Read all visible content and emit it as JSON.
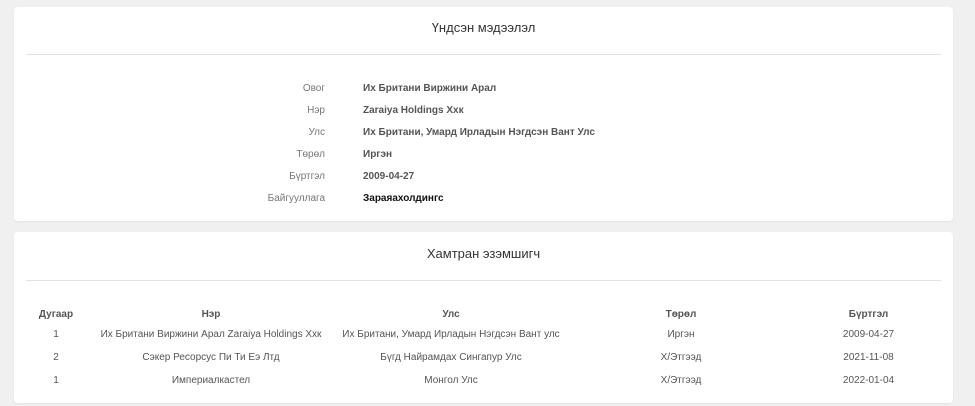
{
  "basic_info": {
    "title": "Үндсэн мэдээлэл",
    "rows": [
      {
        "label": "Овог",
        "value": "Их Британи Виржини Арал"
      },
      {
        "label": "Нэр",
        "value": "Zaraiya Holdings Ххк"
      },
      {
        "label": "Улс",
        "value": "Их Британи, Умард Ирладын Нэгдсэн Вант Улс"
      },
      {
        "label": "Төрөл",
        "value": "Иргэн"
      },
      {
        "label": "Бүртгэл",
        "value": "2009-04-27"
      },
      {
        "label": "Байгууллага",
        "value": "Зараяахолдингс"
      }
    ]
  },
  "co_owners": {
    "title": "Хамтран эзэмшигч",
    "columns": [
      "Дугаар",
      "Нэр",
      "Улс",
      "Төрөл",
      "Бүртгэл"
    ],
    "rows": [
      {
        "num": "1",
        "name": "Их Британи Виржини Арал Zaraiya Holdings Ххк",
        "country": "Их Британи, Умард Ирладын Нэгдсэн Вант улс",
        "type": "Иргэн",
        "date": "2009-04-27"
      },
      {
        "num": "2",
        "name": "Сэкер Ресорсус Пи Ти Еэ Лтд",
        "country": "Бүгд Найрамдах Сингапур Улс",
        "type": "Х/Этгээд",
        "date": "2021-11-08"
      },
      {
        "num": "1",
        "name": "Империалкастел",
        "country": "Монгол Улс",
        "type": "Х/Этгээд",
        "date": "2022-01-04"
      }
    ]
  }
}
